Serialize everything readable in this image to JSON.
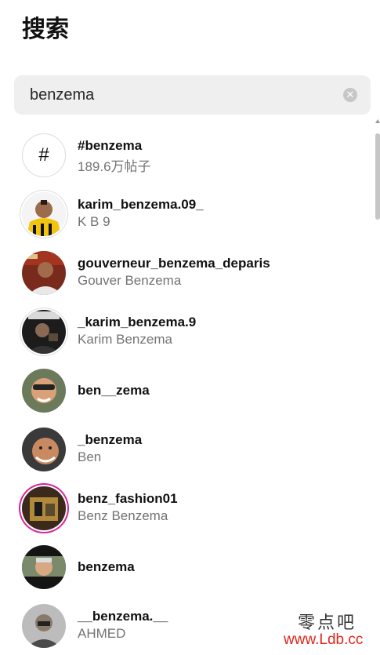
{
  "header": {
    "title": "搜索"
  },
  "search": {
    "value": "benzema"
  },
  "results": [
    {
      "type": "hashtag",
      "glyph": "#",
      "primary": "#benzema",
      "secondary": "189.6万帖子"
    },
    {
      "type": "user",
      "primary": "karim_benzema.09_",
      "secondary": "K B 9"
    },
    {
      "type": "user",
      "primary": "gouverneur_benzema_deparis",
      "secondary": "Gouver Benzema"
    },
    {
      "type": "user",
      "primary": "_karim_benzema.9",
      "secondary": "Karim Benzema"
    },
    {
      "type": "user",
      "primary": "ben__zema",
      "secondary": ""
    },
    {
      "type": "user",
      "primary": "_benzema",
      "secondary": "Ben"
    },
    {
      "type": "user",
      "primary": "benz_fashion01",
      "secondary": "Benz Benzema"
    },
    {
      "type": "user",
      "primary": "benzema",
      "secondary": ""
    },
    {
      "type": "user",
      "primary": "__benzema.__",
      "secondary": "AHMED"
    }
  ],
  "watermark": {
    "chinese": "零点吧",
    "url": "www.Ldb.cc"
  }
}
